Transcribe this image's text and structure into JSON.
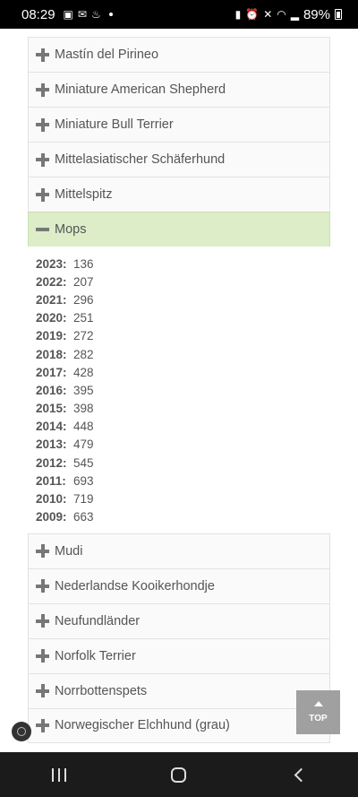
{
  "status_bar": {
    "time": "08:29",
    "battery": "89%"
  },
  "breeds_before": [
    {
      "label": "Mastín del Pirineo"
    },
    {
      "label": "Miniature American Shepherd"
    },
    {
      "label": "Miniature Bull Terrier"
    },
    {
      "label": "Mittelasiatischer Schäferhund"
    },
    {
      "label": "Mittelspitz"
    }
  ],
  "expanded_breed": {
    "label": "Mops",
    "years": [
      {
        "year": "2023:",
        "count": "136"
      },
      {
        "year": "2022:",
        "count": "207"
      },
      {
        "year": "2021:",
        "count": "296"
      },
      {
        "year": "2020:",
        "count": "251"
      },
      {
        "year": "2019:",
        "count": "272"
      },
      {
        "year": "2018:",
        "count": "282"
      },
      {
        "year": "2017:",
        "count": "428"
      },
      {
        "year": "2016:",
        "count": "395"
      },
      {
        "year": "2015:",
        "count": "398"
      },
      {
        "year": "2014:",
        "count": "448"
      },
      {
        "year": "2013:",
        "count": "479"
      },
      {
        "year": "2012:",
        "count": "545"
      },
      {
        "year": "2011:",
        "count": "693"
      },
      {
        "year": "2010:",
        "count": "719"
      },
      {
        "year": "2009:",
        "count": "663"
      }
    ]
  },
  "breeds_after": [
    {
      "label": "Mudi"
    },
    {
      "label": "Nederlandse Kooikerhondje"
    },
    {
      "label": "Neufundländer"
    },
    {
      "label": "Norfolk Terrier"
    },
    {
      "label": "Norrbottenspets"
    },
    {
      "label": "Norwegischer Elchhund (grau)"
    }
  ],
  "top_button": {
    "label": "TOP"
  },
  "colors": {
    "expanded_bg": "#dcedc8",
    "item_bg": "#fafafa",
    "top_button_bg": "#a0a0a0"
  }
}
